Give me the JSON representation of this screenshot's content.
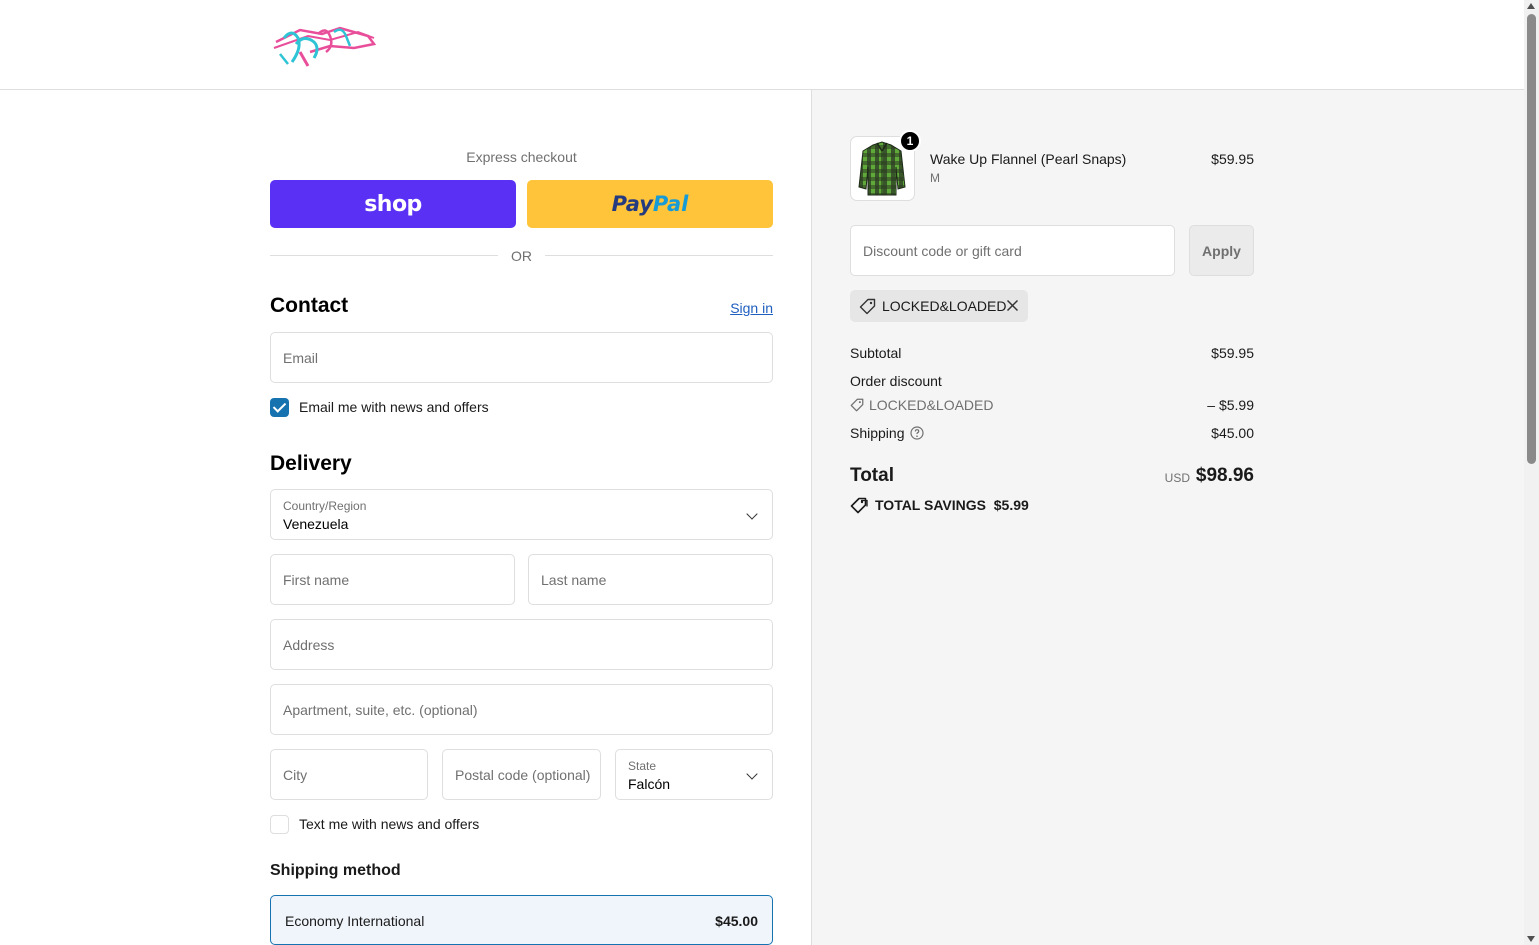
{
  "header": {
    "logo_alt": "Retro"
  },
  "express": {
    "label": "Express checkout",
    "shop_label": "shop",
    "paypal_part1": "Pay",
    "paypal_part2": "Pal",
    "or_label": "OR"
  },
  "contact": {
    "title": "Contact",
    "sign_in": "Sign in",
    "email_placeholder": "Email",
    "news_opt_in": "Email me with news and offers",
    "news_checked": true
  },
  "delivery": {
    "title": "Delivery",
    "country_label": "Country/Region",
    "country_value": "Venezuela",
    "first_name_placeholder": "First name",
    "last_name_placeholder": "Last name",
    "address_placeholder": "Address",
    "apartment_placeholder": "Apartment, suite, etc. (optional)",
    "city_placeholder": "City",
    "postal_placeholder": "Postal code (optional)",
    "state_label": "State",
    "state_value": "Falcón",
    "sms_opt_in": "Text me with news and offers",
    "sms_checked": false
  },
  "shipping_method": {
    "title": "Shipping method",
    "option_name": "Economy International",
    "option_price": "$45.00"
  },
  "order": {
    "item": {
      "name": "Wake Up Flannel (Pearl Snaps)",
      "variant": "M",
      "price": "$59.95",
      "quantity": "1"
    },
    "discount_placeholder": "Discount code or gift card",
    "apply_label": "Apply",
    "applied_code": "LOCKED&LOADED",
    "subtotal_label": "Subtotal",
    "subtotal_value": "$59.95",
    "order_discount_label": "Order discount",
    "discount_code": "LOCKED&LOADED",
    "discount_value": "– $5.99",
    "shipping_label": "Shipping",
    "shipping_value": "$45.00",
    "total_label": "Total",
    "currency": "USD",
    "total_value": "$98.96",
    "savings_label": "TOTAL SAVINGS",
    "savings_value": "$5.99"
  },
  "colors": {
    "shop_purple": "#5a31f4",
    "paypal_yellow": "#ffc439",
    "accent_blue": "#1773b0"
  }
}
